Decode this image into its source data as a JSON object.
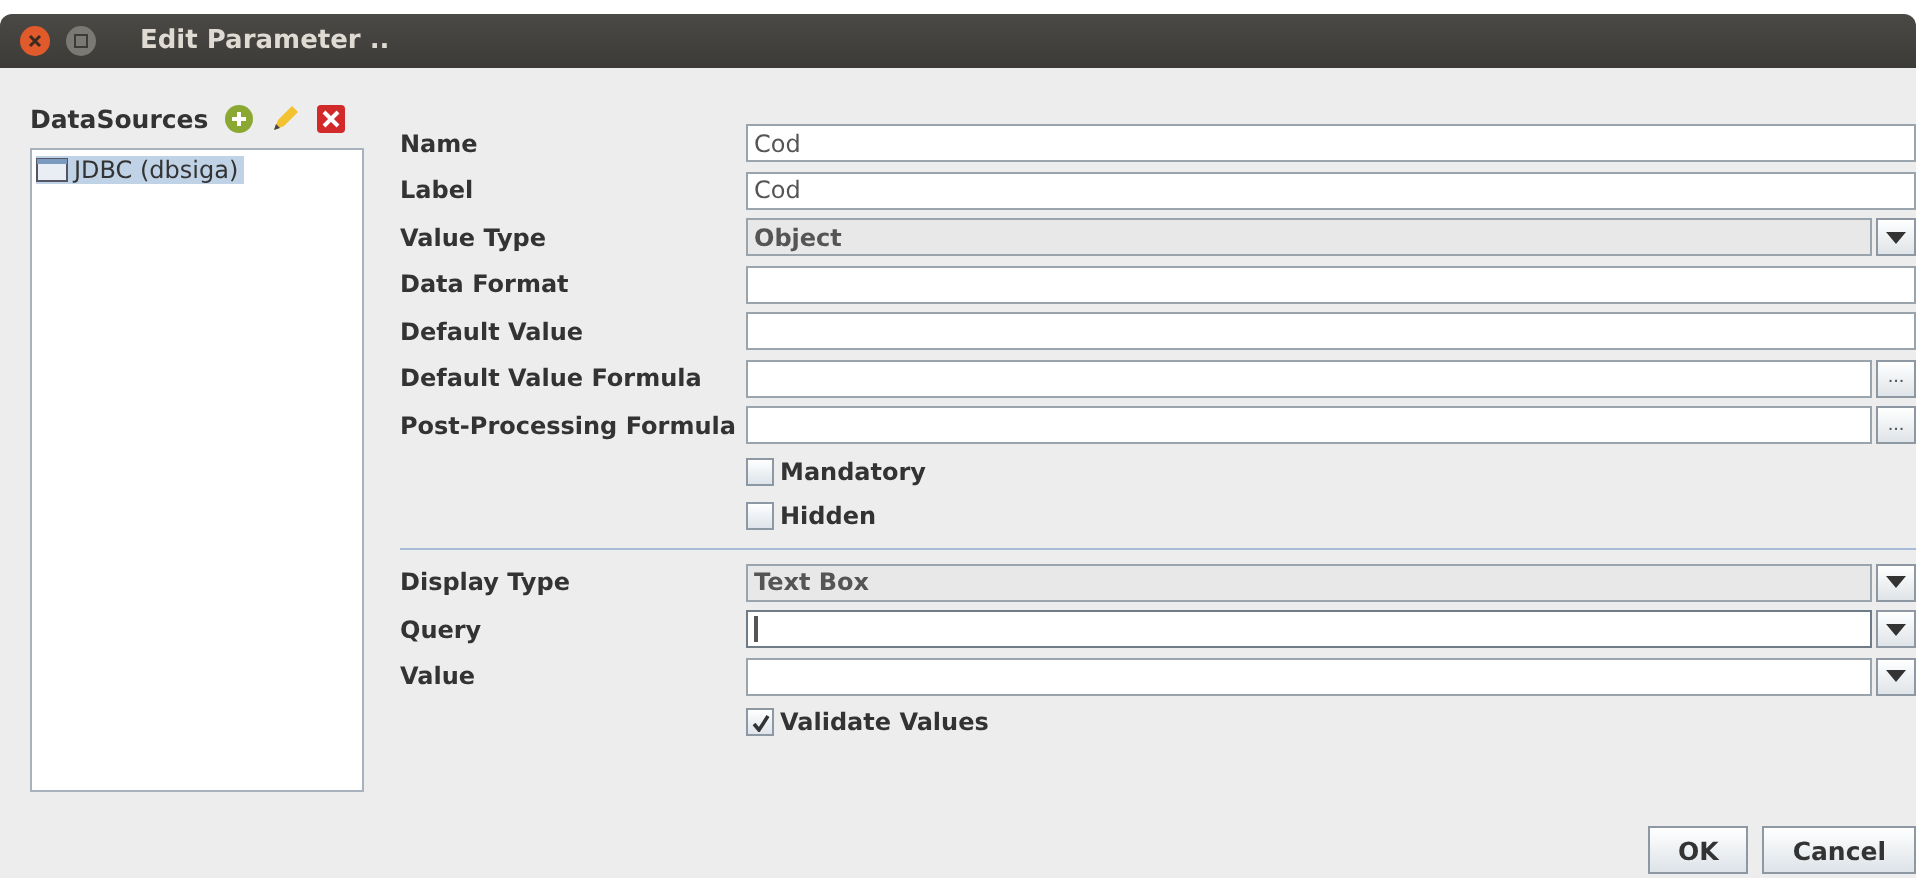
{
  "window": {
    "title": "Edit Parameter .."
  },
  "datasources": {
    "title": "DataSources",
    "items": [
      {
        "label": "JDBC (dbsiga)",
        "selected": true
      }
    ]
  },
  "sections": [
    {
      "fields": [
        {
          "kind": "text",
          "label": "Name",
          "value": "Cod"
        },
        {
          "kind": "text",
          "label": "Label",
          "value": "Cod"
        },
        {
          "kind": "combo",
          "label": "Value Type",
          "value": "Object",
          "editable": false
        },
        {
          "kind": "text",
          "label": "Data Format"
        },
        {
          "kind": "text",
          "label": "Default Value"
        },
        {
          "kind": "formula",
          "label": "Default Value Formula",
          "button": "..."
        },
        {
          "kind": "formula",
          "label": "Post-Processing Formula",
          "button": "..."
        }
      ],
      "checkboxes": [
        {
          "label": "Mandatory",
          "checked": false
        },
        {
          "label": "Hidden",
          "checked": false
        }
      ]
    },
    {
      "fields": [
        {
          "kind": "combo",
          "label": "Display Type",
          "value": "Text Box",
          "editable": false
        },
        {
          "kind": "combo",
          "label": "Query",
          "editable": true,
          "focused": true
        },
        {
          "kind": "combo",
          "label": "Value",
          "editable": true,
          "focused": false
        }
      ],
      "checkboxes": [
        {
          "label": "Validate Values",
          "checked": true
        }
      ]
    }
  ],
  "buttons": [
    "OK",
    "Cancel"
  ]
}
